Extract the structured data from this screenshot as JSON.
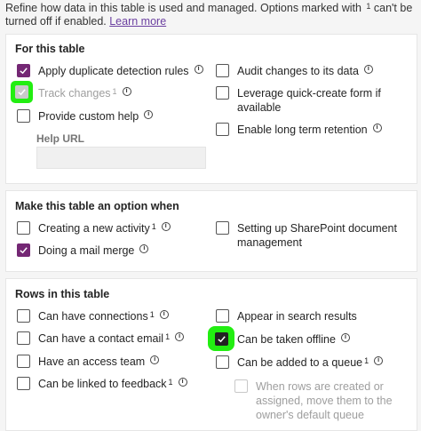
{
  "intro": {
    "text": "Refine how data in this table is used and managed. Options marked with ",
    "sup": "1",
    "text_after": " can't be turned off if enabled.",
    "link": "Learn more"
  },
  "colors": {
    "accent": "#742774",
    "highlight": "#22ee11",
    "link": "#6b3fa0"
  },
  "for_table": {
    "title": "For this table",
    "apply_dup": "Apply duplicate detection rules",
    "track_changes": "Track changes",
    "track_sup": "1",
    "custom_help": "Provide custom help",
    "help_url_label": "Help URL",
    "help_url_value": "",
    "audit": "Audit changes to its data",
    "quick_create_1": "Leverage quick-create form if",
    "quick_create_2": "available",
    "long_term": "Enable long term retention"
  },
  "option_when": {
    "title": "Make this table an option when",
    "new_activity": "Creating a new activity",
    "new_activity_sup": "1",
    "mail_merge": "Doing a mail merge",
    "sharepoint_1": "Setting up SharePoint document",
    "sharepoint_2": "management"
  },
  "rows": {
    "title": "Rows in this table",
    "connections": "Can have connections",
    "connections_sup": "1",
    "contact_email": "Can have a contact email",
    "contact_email_sup": "1",
    "access_team": "Have an access team",
    "feedback": "Can be linked to feedback",
    "feedback_sup": "1",
    "search": "Appear in search results",
    "offline": "Can be taken offline",
    "queue": "Can be added to a queue",
    "queue_sup": "1",
    "queue_move_1": "When rows are created or",
    "queue_move_2": "assigned, move them to the",
    "queue_move_3": "owner's default queue"
  }
}
